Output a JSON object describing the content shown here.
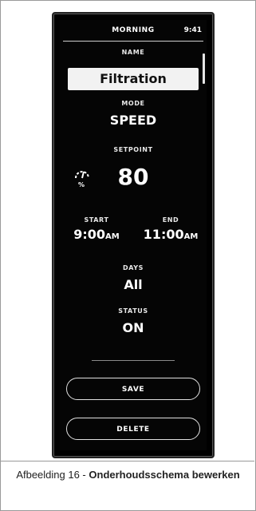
{
  "screen": {
    "header": {
      "title": "MORNING",
      "time": "9:41"
    },
    "name": {
      "label": "NAME",
      "value": "Filtration"
    },
    "mode": {
      "label": "MODE",
      "value": "SPEED"
    },
    "setpoint": {
      "label": "SETPOINT",
      "value": "80",
      "unit": "%",
      "icon": "gauge-icon"
    },
    "start": {
      "label": "START",
      "time": "9:00",
      "ampm": "AM"
    },
    "end": {
      "label": "END",
      "time": "11:00",
      "ampm": "AM"
    },
    "days": {
      "label": "DAYS",
      "value": "All"
    },
    "status": {
      "label": "STATUS",
      "value": "ON"
    },
    "buttons": {
      "save": "SAVE",
      "delete": "DELETE"
    }
  },
  "caption": {
    "prefix": "Afbeelding 16 - ",
    "bold": "Onderhoudsschema bewerken"
  }
}
